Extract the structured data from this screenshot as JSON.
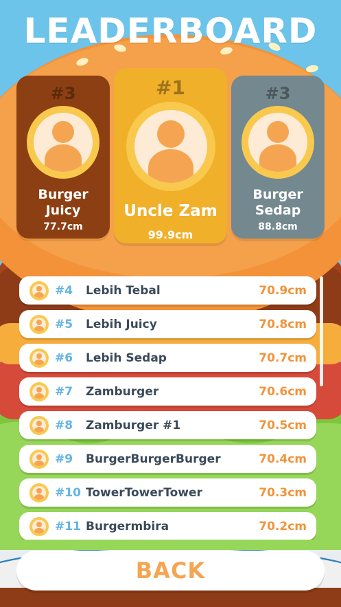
{
  "title": "LEADERBOARD",
  "podium": [
    {
      "rank": "#3",
      "name_line1": "Burger",
      "name_line2": "Juicy",
      "score": "77.7cm",
      "color": "#8c3f12"
    },
    {
      "rank": "#1",
      "name": "Uncle Zam",
      "score": "99.9cm",
      "color": "#f0b02a"
    },
    {
      "rank": "#3",
      "name_line1": "Burger",
      "name_line2": "Sedap",
      "score": "88.8cm",
      "color": "#74888f"
    }
  ],
  "list": [
    {
      "rank": "#4",
      "name": "Lebih Tebal",
      "score": "70.9cm"
    },
    {
      "rank": "#5",
      "name": "Lebih Juicy",
      "score": "70.8cm"
    },
    {
      "rank": "#6",
      "name": "Lebih Sedap",
      "score": "70.7cm"
    },
    {
      "rank": "#7",
      "name": "Zamburger",
      "score": "70.6cm"
    },
    {
      "rank": "#8",
      "name": "Zamburger #1",
      "score": "70.5cm"
    },
    {
      "rank": "#9",
      "name": "BurgerBurgerBurger",
      "score": "70.4cm"
    },
    {
      "rank": "#10",
      "name": "TowerTowerTower",
      "score": "70.3cm"
    },
    {
      "rank": "#11",
      "name": "Burgermbira",
      "score": "70.2cm"
    }
  ],
  "back_label": "BACK",
  "colors": {
    "sky": "#6cc4ea",
    "bun": "#f5993b",
    "rank_text": "#63b5e3",
    "score_text": "#f2933b",
    "name_text": "#3b4a5a",
    "avatar_ring": "#f9c94d"
  }
}
